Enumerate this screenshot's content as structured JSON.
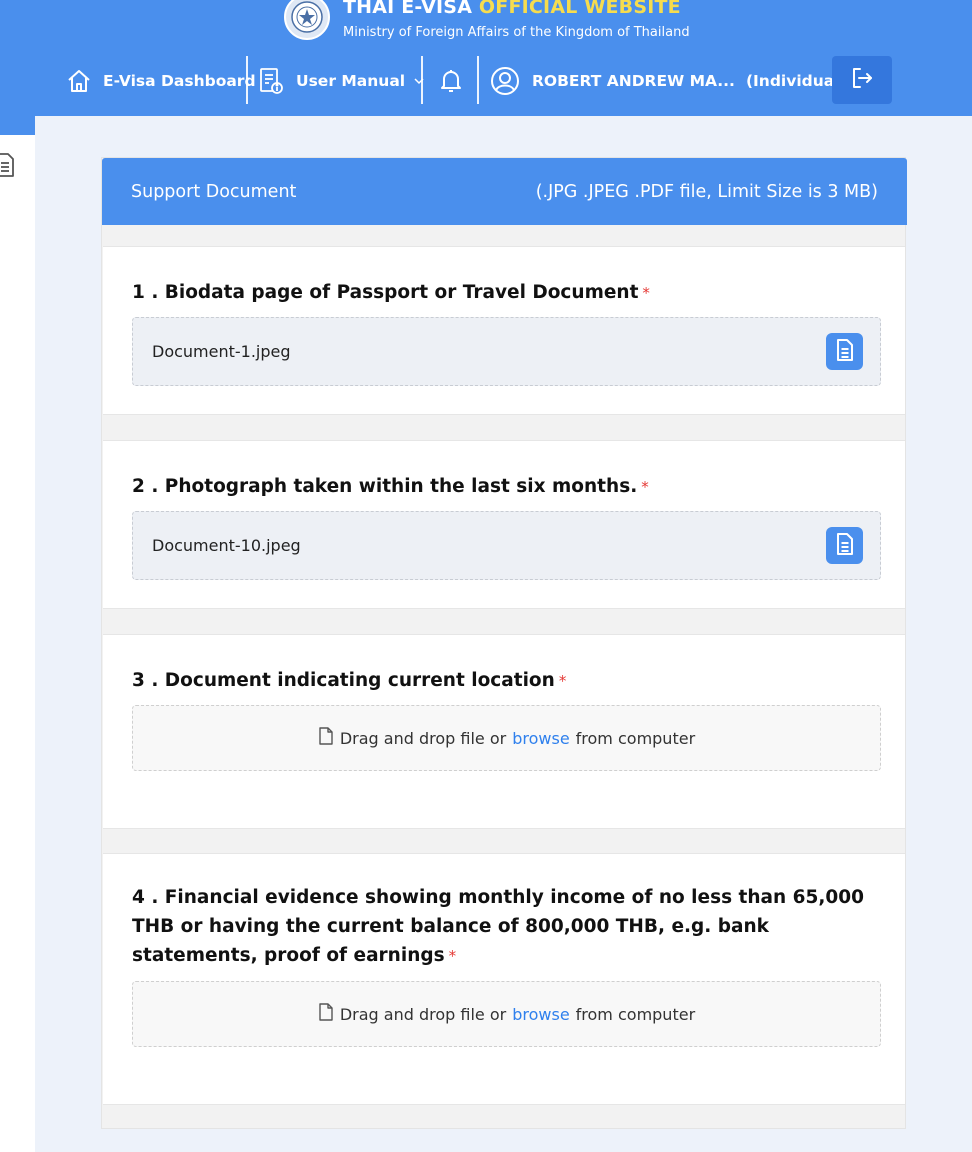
{
  "header": {
    "title_part1": "THAI E-VISA ",
    "title_part2": "OFFICIAL WEBSITE",
    "subtitle": "Ministry of Foreign Affairs of the Kingdom of Thailand",
    "nav": {
      "dashboard_label": "E-Visa Dashboard",
      "manual_label": "User Manual",
      "user_name": "ROBERT ANDREW MA...",
      "user_type": "(Individual)"
    }
  },
  "card": {
    "title": "Support Document",
    "limit_note": "(.JPG .JPEG .PDF file, Limit Size is 3 MB)",
    "sections": [
      {
        "title": "1 . Biodata page of Passport or Travel Document",
        "required": "*",
        "file_name": "Document-1.jpeg"
      },
      {
        "title": "2 . Photograph taken within the last six months.",
        "required": "*",
        "file_name": "Document-10.jpeg"
      },
      {
        "title": "3 . Document indicating current location",
        "required": "*"
      },
      {
        "title": "4 . Financial evidence showing monthly income of no less than 65,000 THB or having the current balance of 800,000 THB, e.g. bank statements, proof of earnings",
        "required": "*"
      }
    ],
    "drop": {
      "text_before": "Drag and drop file or",
      "browse_label": "browse",
      "text_after": "from computer"
    }
  },
  "colors": {
    "primary": "#4a8fed",
    "accent_yellow": "#f6dc4e",
    "link": "#2f80ed",
    "required": "#e53935"
  }
}
